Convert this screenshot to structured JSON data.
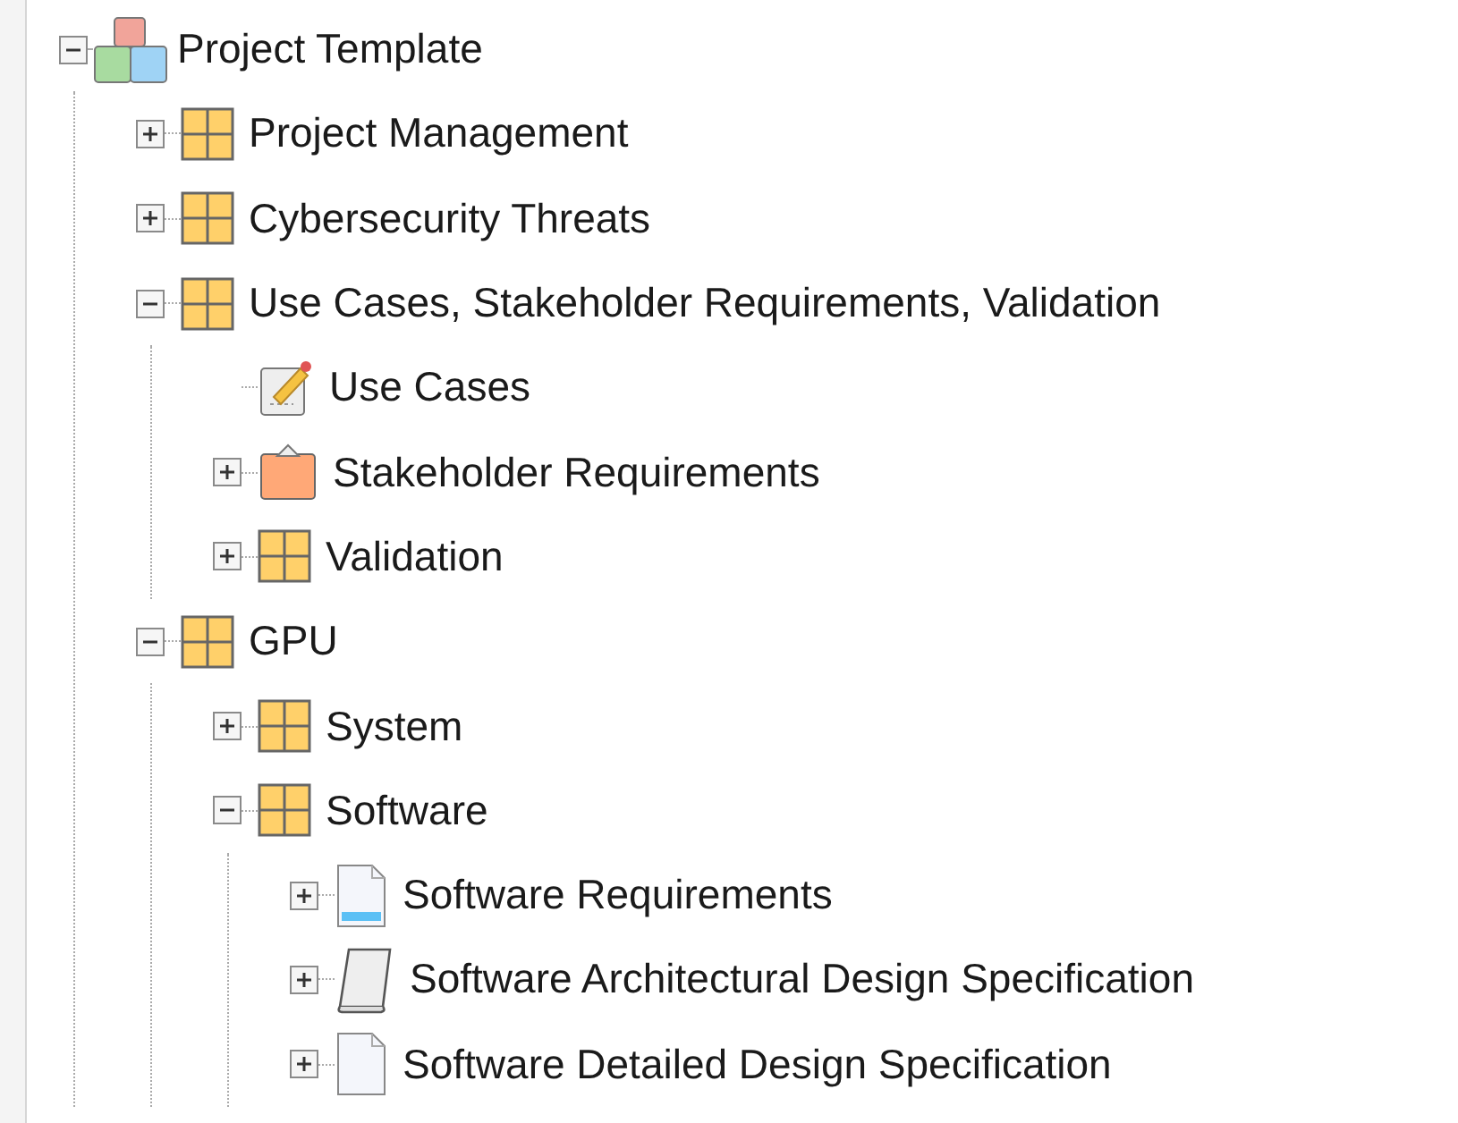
{
  "tree": [
    {
      "label": "Project Template",
      "kind": "blocks",
      "expanded": true,
      "children": [
        {
          "label": "Project Management",
          "kind": "package",
          "expanded": false
        },
        {
          "label": "Cybersecurity Threats",
          "kind": "package",
          "expanded": false
        },
        {
          "label": "Use Cases, Stakeholder Requirements, Validation",
          "kind": "package",
          "expanded": true,
          "children": [
            {
              "label": "Use Cases",
              "kind": "usecase"
            },
            {
              "label": "Stakeholder Requirements",
              "kind": "clipboard",
              "expanded": false
            },
            {
              "label": "Validation",
              "kind": "package",
              "expanded": false
            }
          ]
        },
        {
          "label": "GPU",
          "kind": "package",
          "expanded": true,
          "children": [
            {
              "label": "System",
              "kind": "package",
              "expanded": false
            },
            {
              "label": "Software",
              "kind": "package",
              "expanded": true,
              "children": [
                {
                  "label": "Software Requirements",
                  "kind": "reqdoc",
                  "expanded": false
                },
                {
                  "label": "Software Architectural Design Specification",
                  "kind": "scroll",
                  "expanded": false
                },
                {
                  "label": "Software Detailed Design Specification",
                  "kind": "page",
                  "expanded": false
                }
              ]
            }
          ]
        }
      ]
    }
  ]
}
